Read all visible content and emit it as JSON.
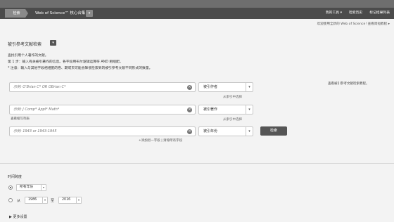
{
  "nav": {
    "search_tab": "检索",
    "product": "Web of Science™ 核心合集",
    "product_drop_icon": "chevron-down-icon",
    "right_links": [
      "我的工具 ▾",
      "检索历史",
      "标记结果列表"
    ]
  },
  "welcome": "欢迎使用全新的 Web of Science! 查看简短教程 ▸",
  "section": {
    "title": "被引参考文献检索",
    "drop_icon": "chevron-down-icon"
  },
  "intro": {
    "line1": "查找引用个人著作的文献。",
    "line2": "第 1 步：输入有关被引著作的信息。各字段用布尔逻辑运算符 AND 相组配。",
    "line3": "* 注意：输入与其他字段相组配的卷、期或页可能会降低检索到的被引参考文献不同形式的数量。"
  },
  "fields": [
    {
      "placeholder": "示例: O'Brian C* OR OBrian C*",
      "select": "被引作者",
      "from_index": "从索引中选择"
    },
    {
      "placeholder": "示例: J Comp* Appl* Math*",
      "select": "被引著作",
      "from_index": "从索引中选择"
    },
    {
      "placeholder": "示例: 1943 or 1943-1945",
      "select": "被引年份"
    }
  ],
  "abbr_link": "查看缩写列表",
  "row_actions": "+添加另一字段 | 清除所有字段",
  "search_button": "检索",
  "side_link": "查看被引参考文献检索教程。",
  "time_span": {
    "title": "时间跨度",
    "all_years": "所有年份",
    "from_label": "从",
    "from_year": "1986",
    "to_label": "至",
    "to_year": "2016"
  },
  "more_settings": "更多设置"
}
